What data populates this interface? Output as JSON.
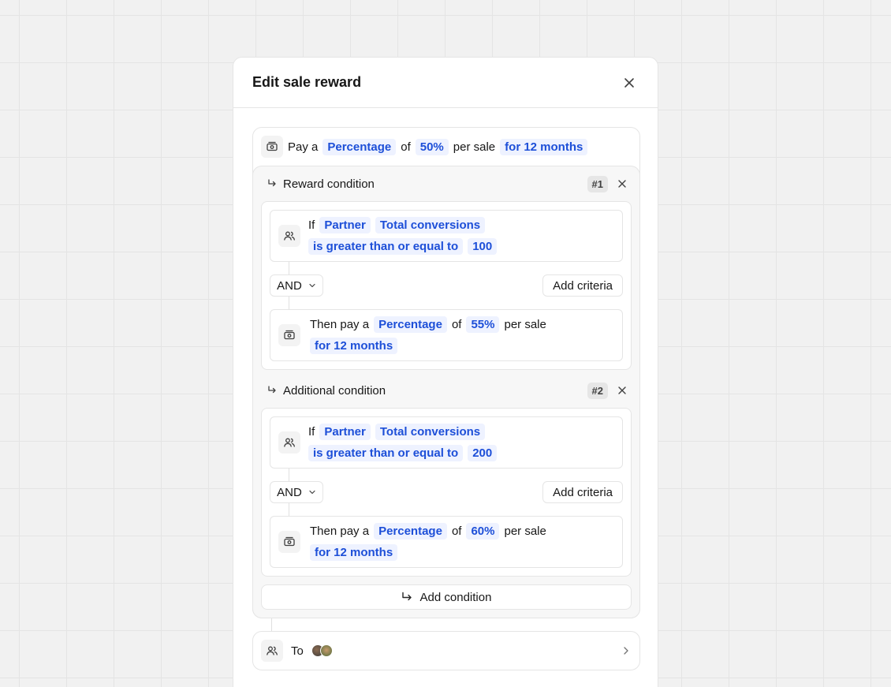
{
  "modal": {
    "title": "Edit sale reward"
  },
  "reward": {
    "pay_a": "Pay a",
    "type": "Percentage",
    "of": "of",
    "amount": "50%",
    "per_sale": "per sale",
    "duration": "for 12 months"
  },
  "conditions": [
    {
      "title": "Reward condition",
      "badge": "#1",
      "if_label": "If",
      "entity": "Partner",
      "attribute": "Total conversions",
      "operator": "is greater than or equal to",
      "value": "100",
      "logic": "AND",
      "add_criteria": "Add criteria",
      "then_pay_a": "Then pay a",
      "type": "Percentage",
      "of": "of",
      "amount": "55%",
      "per_sale": "per sale",
      "duration": "for 12 months"
    },
    {
      "title": "Additional condition",
      "badge": "#2",
      "if_label": "If",
      "entity": "Partner",
      "attribute": "Total conversions",
      "operator": "is greater than or equal to",
      "value": "200",
      "logic": "AND",
      "add_criteria": "Add criteria",
      "then_pay_a": "Then pay a",
      "type": "Percentage",
      "of": "of",
      "amount": "60%",
      "per_sale": "per sale",
      "duration": "for 12 months"
    }
  ],
  "add_condition_label": "Add condition",
  "to": {
    "label": "To"
  },
  "icons": {
    "close": "close-icon",
    "money": "money-icon",
    "users": "users-icon",
    "arrow": "corner-down-right-icon",
    "chevron_down": "chevron-down-icon",
    "chevron_right": "chevron-right-icon"
  },
  "colors": {
    "accent": "#1d4fd8",
    "pill_bg": "#eef2ff"
  }
}
